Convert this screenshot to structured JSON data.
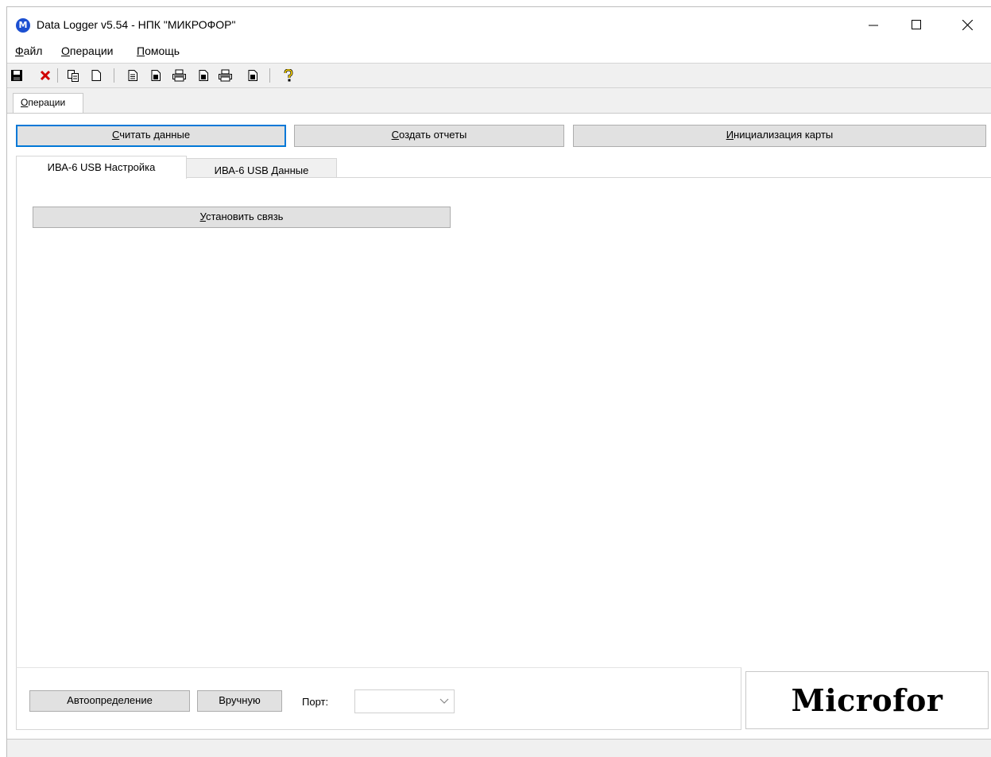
{
  "window": {
    "title": "Data Logger v5.54  -  НПК \"МИКРОФОР\"",
    "icon_letter": "M"
  },
  "menu": {
    "file": {
      "underline": "Ф",
      "rest": "айл"
    },
    "operations": {
      "underline": "О",
      "rest": "перации"
    },
    "help": {
      "underline": "П",
      "rest": "омощь"
    }
  },
  "toolbar": {
    "icons": [
      "save-icon",
      "delete-icon",
      "copy-icon",
      "new-doc-icon",
      "document-icon",
      "document-dark-icon",
      "print-icon",
      "document-dark-icon",
      "print-icon",
      "document-dark-icon",
      "help-icon"
    ]
  },
  "outer_tab": {
    "underline": "О",
    "rest": "перации"
  },
  "actions": {
    "read": {
      "underline": "С",
      "rest": "читать данные"
    },
    "report": {
      "underline": "С",
      "rest": "оздать отчеты"
    },
    "init": {
      "underline": "И",
      "rest": "нициализация карты"
    }
  },
  "tabs": {
    "setup": "ИВА-6 USB Настройка",
    "data": "ИВА-6 USB Данные"
  },
  "connect": {
    "underline": "У",
    "rest": "становить связь"
  },
  "bottom": {
    "auto": "Автоопределение",
    "manual": "Вручную",
    "port_label": "Порт:",
    "port_value": ""
  },
  "logo": {
    "text": "Microfor"
  },
  "colors": {
    "focus": "#0078d7",
    "button_bg": "#e1e1e1",
    "panel_bg": "#f0f0f0"
  }
}
